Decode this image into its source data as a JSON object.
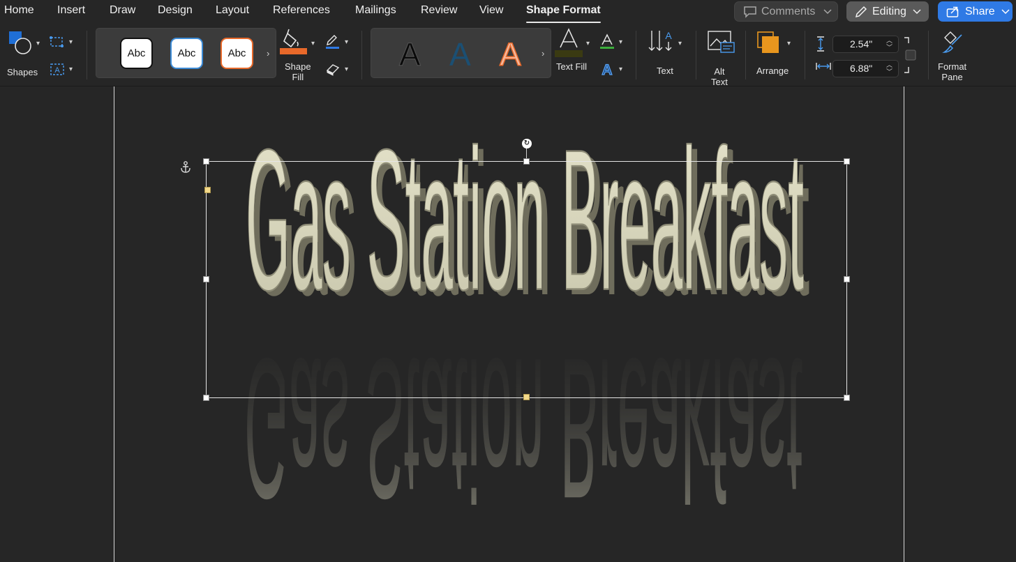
{
  "tabs": [
    {
      "label": "Home"
    },
    {
      "label": "Insert"
    },
    {
      "label": "Draw"
    },
    {
      "label": "Design"
    },
    {
      "label": "Layout"
    },
    {
      "label": "References"
    },
    {
      "label": "Mailings"
    },
    {
      "label": "Review"
    },
    {
      "label": "View"
    },
    {
      "label": "Shape Format",
      "active": true
    }
  ],
  "top_right": {
    "comments_label": "Comments",
    "editing_label": "Editing",
    "share_label": "Share"
  },
  "ribbon": {
    "shapes_label": "Shapes",
    "shape_styles": [
      "Abc",
      "Abc",
      "Abc"
    ],
    "shape_fill_label": "Shape\nFill",
    "wordart_styles": [
      "A",
      "A",
      "A"
    ],
    "text_fill_label": "Text Fill",
    "text_label": "Text",
    "alt_text_label": "Alt\nText",
    "arrange_label": "Arrange",
    "height_value": "2.54\"",
    "width_value": "6.88\"",
    "format_pane_label": "Format\nPane"
  },
  "colors": {
    "accent_orange": "#e8692a",
    "accent_blue": "#2f7ae5",
    "wordart_face": "#d8d6bd",
    "text_fill_swatch": "#3a3a12",
    "arrange_swatch": "#e8961e"
  },
  "document": {
    "wordart_text": "Gas Station Breakfast"
  }
}
